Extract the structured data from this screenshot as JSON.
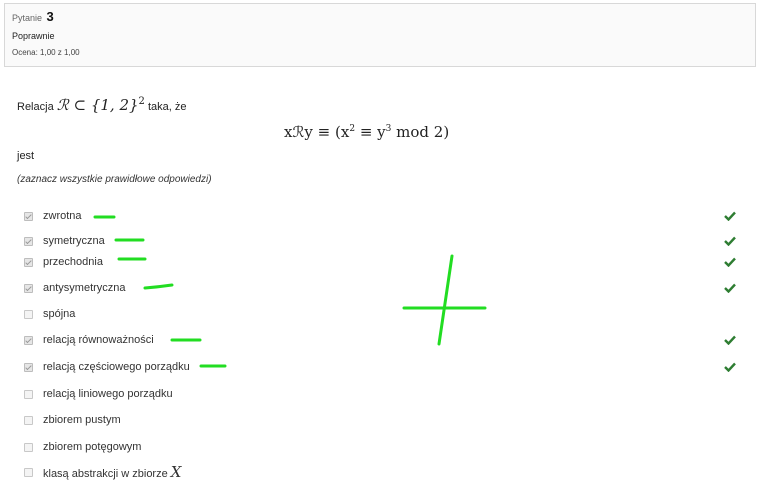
{
  "info": {
    "question_prefix": "Pytanie",
    "question_number": "3",
    "state": "Poprawnie",
    "grade": "Ocena: 1,00 z 1,00"
  },
  "question": {
    "intro": "Relacja",
    "relation_math": "ℛ ⊂ {1, 2}",
    "relation_exp": "2",
    "intro_end": "taka, że",
    "formula_lhs": "xℛy ≡ (x",
    "formula_exp1": "2",
    "formula_mid": " ≡ y",
    "formula_exp2": "3",
    "formula_rhs": "  mod 2)",
    "jest": "jest",
    "hint": "(zaznacz wszystkie prawidłowe odpowiedzi)"
  },
  "options": [
    {
      "label": "zwrotna",
      "checked": true,
      "correct": true
    },
    {
      "label": "symetryczna",
      "checked": true,
      "correct": true
    },
    {
      "label": "przechodnia",
      "checked": true,
      "correct": true
    },
    {
      "label": "antysymetryczna",
      "checked": true,
      "correct": true
    },
    {
      "label": "spójna",
      "checked": false,
      "correct": false
    },
    {
      "label": "relacją równoważności",
      "checked": true,
      "correct": true
    },
    {
      "label": "relacją częściowego porządku",
      "checked": true,
      "correct": true
    },
    {
      "label": "relacją liniowego porządku",
      "checked": false,
      "correct": false
    },
    {
      "label": "zbiorem pustym",
      "checked": false,
      "correct": false
    },
    {
      "label": "zbiorem potęgowym",
      "checked": false,
      "correct": false
    },
    {
      "label": "klasą abstrakcji w zbiorze",
      "math": "X",
      "checked": false,
      "correct": false
    }
  ],
  "colors": {
    "tick": "#2e7d32",
    "annotation": "#22dd22"
  }
}
